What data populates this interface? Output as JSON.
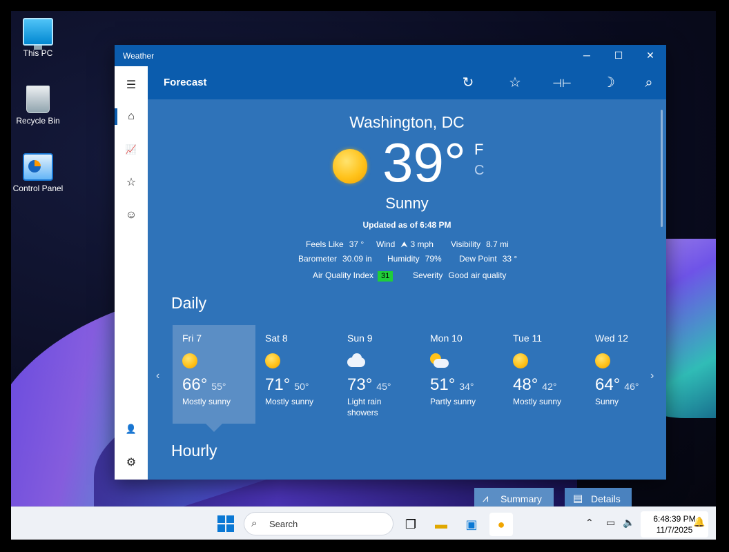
{
  "desktop": {
    "icons": [
      {
        "label": "This PC"
      },
      {
        "label": "Recycle Bin"
      },
      {
        "label": "Control Panel"
      }
    ]
  },
  "window": {
    "title": "Weather",
    "controls": {
      "minimize": "─",
      "maximize": "☐",
      "close": "✕"
    }
  },
  "appbar": {
    "title": "Forecast",
    "icons": [
      "refresh-icon",
      "favorite-star-icon",
      "pin-icon",
      "dark-mode-moon-icon",
      "search-icon"
    ]
  },
  "sidebar": {
    "items": [
      {
        "name": "menu-icon",
        "glyph": "☰"
      },
      {
        "name": "home-icon",
        "glyph": "⌂"
      },
      {
        "name": "historical-chart-icon",
        "glyph": "📈"
      },
      {
        "name": "favorites-list-icon",
        "glyph": "☆"
      },
      {
        "name": "life-icon",
        "glyph": "☺"
      },
      {
        "name": "account-icon",
        "glyph": "👤"
      },
      {
        "name": "settings-icon",
        "glyph": "⚙"
      }
    ]
  },
  "current": {
    "city": "Washington, DC",
    "temp": "39°",
    "unit_f": "F",
    "unit_c": "C",
    "condition": "Sunny",
    "updated": "Updated as of 6:48 PM",
    "details": {
      "feels_like_label": "Feels Like",
      "feels_like": "37 °",
      "wind_label": "Wind",
      "wind": "3 mph",
      "visibility_label": "Visibility",
      "visibility": "8.7 mi",
      "barometer_label": "Barometer",
      "barometer": "30.09 in",
      "humidity_label": "Humidity",
      "humidity": "79%",
      "dew_point_label": "Dew Point",
      "dew_point": "33 °",
      "aqi_label": "Air Quality Index",
      "aqi": "31",
      "severity_label": "Severity",
      "severity": "Good air quality"
    },
    "aqi_color": "#1fce3a"
  },
  "daily": {
    "heading": "Daily",
    "days": [
      {
        "day": "Fri 7",
        "hi": "66°",
        "lo": "55°",
        "desc": "Mostly sunny",
        "icon": "sun"
      },
      {
        "day": "Sat 8",
        "hi": "71°",
        "lo": "50°",
        "desc": "Mostly sunny",
        "icon": "sun"
      },
      {
        "day": "Sun 9",
        "hi": "73°",
        "lo": "45°",
        "desc": "Light rain showers",
        "icon": "cloud"
      },
      {
        "day": "Mon 10",
        "hi": "51°",
        "lo": "34°",
        "desc": "Partly sunny",
        "icon": "psun"
      },
      {
        "day": "Tue 11",
        "hi": "48°",
        "lo": "42°",
        "desc": "Mostly sunny",
        "icon": "sun"
      },
      {
        "day": "Wed 12",
        "hi": "64°",
        "lo": "46°",
        "desc": "Sunny",
        "icon": "sun"
      }
    ]
  },
  "hourly": {
    "heading": "Hourly",
    "summary_label": "Summary",
    "details_label": "Details"
  },
  "taskbar": {
    "search_placeholder": "Search",
    "time": "6:48:39 PM",
    "date": "11/7/2025"
  },
  "colors": {
    "app_bg": "#2f73b9",
    "titlebar": "#0b5cad",
    "selected_day": "#5b8ec5"
  }
}
